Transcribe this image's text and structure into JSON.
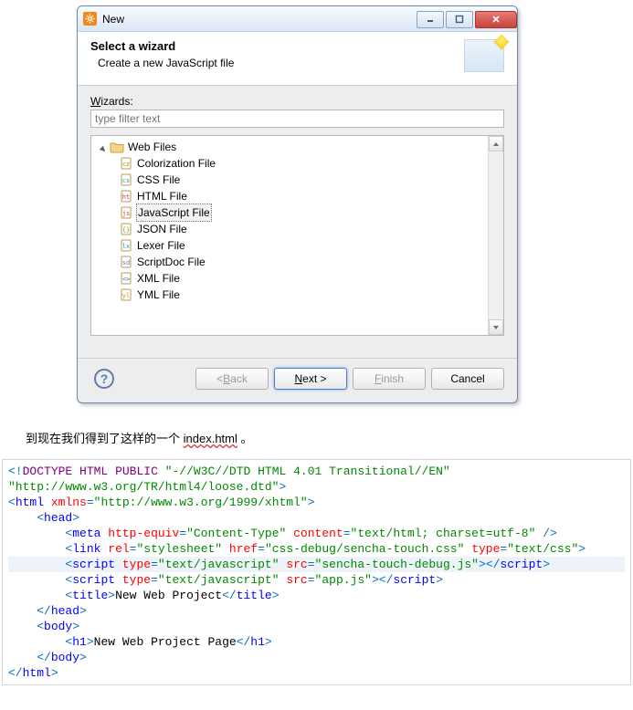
{
  "dialog": {
    "title": "New",
    "banner_title": "Select a wizard",
    "banner_sub": "Create a new JavaScript file",
    "wizards_label_pre": "W",
    "wizards_label_post": "izards:",
    "filter_placeholder": "type filter text",
    "tree": {
      "root": "Web Files",
      "items": [
        "Colorization File",
        "CSS File",
        "HTML File",
        "JavaScript File",
        "JSON File",
        "Lexer File",
        "ScriptDoc File",
        "XML File",
        "YML File"
      ],
      "selected_index": 3
    },
    "buttons": {
      "help": "?",
      "back_pre": "< ",
      "back_u": "B",
      "back_post": "ack",
      "next_u": "N",
      "next_post": "ext >",
      "finish_u": "F",
      "finish_post": "inish",
      "cancel": "Cancel"
    }
  },
  "paragraph": {
    "pre": "到现在我们得到了这样的一个 ",
    "mis": "index.html",
    "post": " 。"
  },
  "code": {
    "lines": [
      {
        "indent": 0,
        "segs": [
          [
            "ang",
            "<!"
          ],
          [
            "kw",
            "DOCTYPE"
          ],
          [
            "txt",
            " "
          ],
          [
            "kw",
            "HTML"
          ],
          [
            "txt",
            " "
          ],
          [
            "kw",
            "PUBLIC"
          ],
          [
            "txt",
            " "
          ],
          [
            "str",
            "\"-//W3C//DTD HTML 4.01 Transitional//EN\""
          ]
        ]
      },
      {
        "indent": 0,
        "segs": [
          [
            "str",
            "\"http://www.w3.org/TR/html4/loose.dtd\""
          ],
          [
            "ang",
            ">"
          ]
        ]
      },
      {
        "indent": 0,
        "segs": [
          [
            "ang",
            "<"
          ],
          [
            "tag",
            "html"
          ],
          [
            "txt",
            " "
          ],
          [
            "attr",
            "xmlns"
          ],
          [
            "ang",
            "="
          ],
          [
            "str",
            "\"http://www.w3.org/1999/xhtml\""
          ],
          [
            "ang",
            ">"
          ]
        ]
      },
      {
        "indent": 1,
        "segs": [
          [
            "ang",
            "<"
          ],
          [
            "tag",
            "head"
          ],
          [
            "ang",
            ">"
          ]
        ]
      },
      {
        "indent": 2,
        "segs": [
          [
            "ang",
            "<"
          ],
          [
            "tag",
            "meta"
          ],
          [
            "txt",
            " "
          ],
          [
            "attr",
            "http-equiv"
          ],
          [
            "ang",
            "="
          ],
          [
            "str",
            "\"Content-Type\""
          ],
          [
            "txt",
            " "
          ],
          [
            "attr",
            "content"
          ],
          [
            "ang",
            "="
          ],
          [
            "str",
            "\"text/html; charset=utf-8\""
          ],
          [
            "txt",
            " "
          ],
          [
            "ang",
            "/>"
          ]
        ]
      },
      {
        "indent": 2,
        "segs": [
          [
            "ang",
            "<"
          ],
          [
            "tag",
            "link"
          ],
          [
            "txt",
            " "
          ],
          [
            "attr",
            "rel"
          ],
          [
            "ang",
            "="
          ],
          [
            "str",
            "\"stylesheet\""
          ],
          [
            "txt",
            " "
          ],
          [
            "attr",
            "href"
          ],
          [
            "ang",
            "="
          ],
          [
            "str",
            "\"css-debug/sencha-touch.css\""
          ],
          [
            "txt",
            " "
          ],
          [
            "attr",
            "type"
          ],
          [
            "ang",
            "="
          ],
          [
            "str",
            "\"text/css\""
          ],
          [
            "ang",
            ">"
          ]
        ]
      },
      {
        "indent": 2,
        "hl": true,
        "segs": [
          [
            "ang",
            "<"
          ],
          [
            "tag",
            "script"
          ],
          [
            "txt",
            " "
          ],
          [
            "attr",
            "type"
          ],
          [
            "ang",
            "="
          ],
          [
            "str",
            "\"text/javascript\""
          ],
          [
            "txt",
            " "
          ],
          [
            "attr",
            "src"
          ],
          [
            "ang",
            "="
          ],
          [
            "str",
            "\"sencha-touch-debug.js\""
          ],
          [
            "ang",
            ">"
          ],
          [
            "ang",
            "</"
          ],
          [
            "tag",
            "script"
          ],
          [
            "ang",
            ">"
          ]
        ]
      },
      {
        "indent": 2,
        "segs": [
          [
            "ang",
            "<"
          ],
          [
            "tag",
            "script"
          ],
          [
            "txt",
            " "
          ],
          [
            "attr",
            "type"
          ],
          [
            "ang",
            "="
          ],
          [
            "str",
            "\"text/javascript\""
          ],
          [
            "txt",
            " "
          ],
          [
            "attr",
            "src"
          ],
          [
            "ang",
            "="
          ],
          [
            "str",
            "\"app.js\""
          ],
          [
            "ang",
            ">"
          ],
          [
            "ang",
            "</"
          ],
          [
            "tag",
            "script"
          ],
          [
            "ang",
            ">"
          ]
        ]
      },
      {
        "indent": 2,
        "segs": [
          [
            "ang",
            "<"
          ],
          [
            "tag",
            "title"
          ],
          [
            "ang",
            ">"
          ],
          [
            "txt",
            "New Web Project"
          ],
          [
            "ang",
            "</"
          ],
          [
            "tag",
            "title"
          ],
          [
            "ang",
            ">"
          ]
        ]
      },
      {
        "indent": 1,
        "segs": [
          [
            "ang",
            "</"
          ],
          [
            "tag",
            "head"
          ],
          [
            "ang",
            ">"
          ]
        ]
      },
      {
        "indent": 1,
        "segs": [
          [
            "ang",
            "<"
          ],
          [
            "tag",
            "body"
          ],
          [
            "ang",
            ">"
          ]
        ]
      },
      {
        "indent": 2,
        "segs": [
          [
            "ang",
            "<"
          ],
          [
            "tag",
            "h1"
          ],
          [
            "ang",
            ">"
          ],
          [
            "txt",
            "New Web Project Page"
          ],
          [
            "ang",
            "</"
          ],
          [
            "tag",
            "h1"
          ],
          [
            "ang",
            ">"
          ]
        ]
      },
      {
        "indent": 1,
        "segs": [
          [
            "ang",
            "</"
          ],
          [
            "tag",
            "body"
          ],
          [
            "ang",
            ">"
          ]
        ]
      },
      {
        "indent": 0,
        "segs": [
          [
            "ang",
            "</"
          ],
          [
            "tag",
            "html"
          ],
          [
            "ang",
            ">"
          ]
        ]
      }
    ]
  }
}
